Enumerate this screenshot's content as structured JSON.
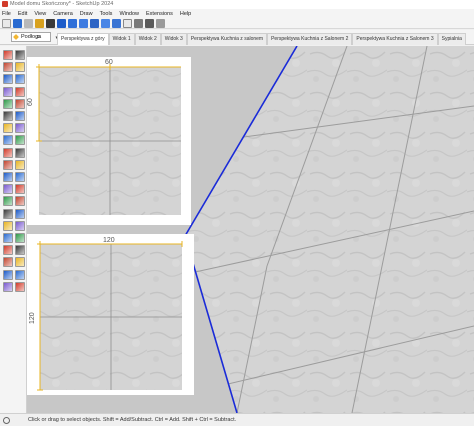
{
  "window": {
    "title": "Model domu Skończony* - SketchUp 2024"
  },
  "menu": [
    "File",
    "Edit",
    "View",
    "Camera",
    "Draw",
    "Tools",
    "Window",
    "Extensions",
    "Help"
  ],
  "tray": {
    "tag_selector": "Podłoga"
  },
  "tabs": [
    {
      "label": "Perspektywa z góry",
      "active": true
    },
    {
      "label": "Widok 1",
      "active": false
    },
    {
      "label": "Widok 2",
      "active": false
    },
    {
      "label": "Widok 3",
      "active": false
    },
    {
      "label": "Perspektywa Kuchnia z salonem",
      "active": false
    },
    {
      "label": "Perspektywa Kuchnia z Salonem 2",
      "active": false
    },
    {
      "label": "Perspektywa Kuchnia z Salonem 3",
      "active": false
    },
    {
      "label": "Sypialnia",
      "active": false
    }
  ],
  "panels": {
    "top": {
      "dim_width": "60",
      "dim_height": "60"
    },
    "bottom": {
      "dim_width": "120",
      "dim_height": "120"
    }
  },
  "status": {
    "text": "Click or drag to select objects. Shift = Add/Subtract. Ctrl = Add. Shift + Ctrl = Subtract."
  },
  "colors": {
    "accent_dimension": "#e8b422",
    "floor_edge": "#1a2bd8",
    "viewport_bg": "#c7c7c7",
    "tile": "#d4d4d4"
  }
}
